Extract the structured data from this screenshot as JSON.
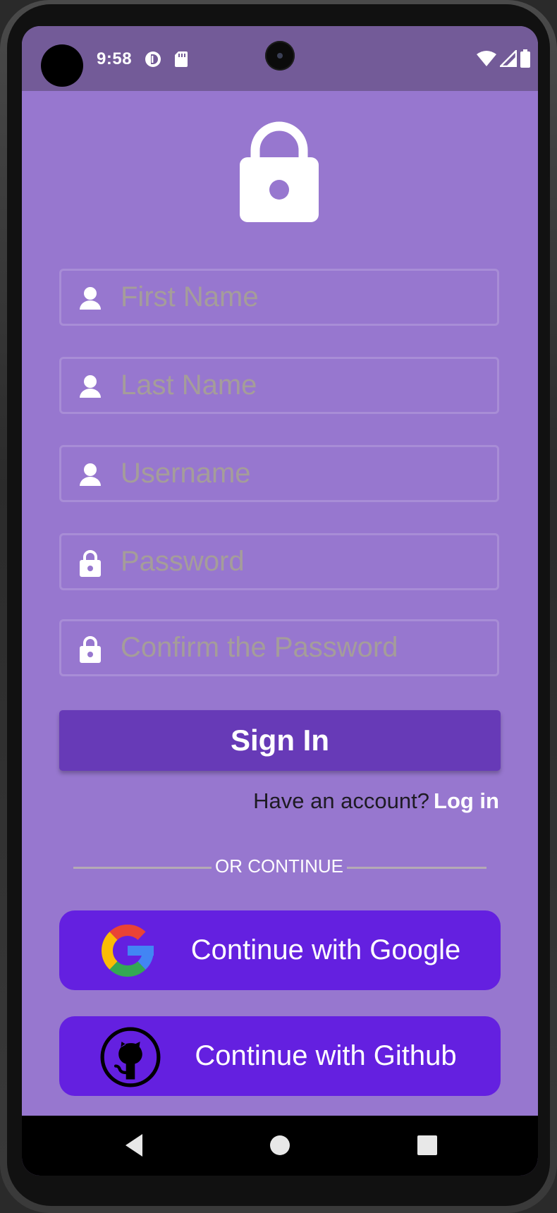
{
  "status_bar": {
    "time": "9:58",
    "icons": [
      "notification-circle-icon",
      "sd-card-icon",
      "wifi-icon",
      "cellular-signal-icon",
      "battery-icon"
    ]
  },
  "form": {
    "first_name_placeholder": "First Name",
    "last_name_placeholder": "Last Name",
    "username_placeholder": "Username",
    "password_placeholder": "Password",
    "confirm_password_placeholder": "Confirm the Password",
    "sign_in_label": "Sign In",
    "account_prompt": "Have an account?",
    "login_link": "Log in"
  },
  "divider": {
    "text": "OR CONTINUE"
  },
  "social": {
    "google_label": "Continue with Google",
    "github_label": "Continue with Github"
  },
  "colors": {
    "background": "#9777cf",
    "status_bar": "#735b98",
    "sign_in_button": "#673ab7",
    "social_button": "#6420e0",
    "placeholder": "#a59d9a"
  }
}
